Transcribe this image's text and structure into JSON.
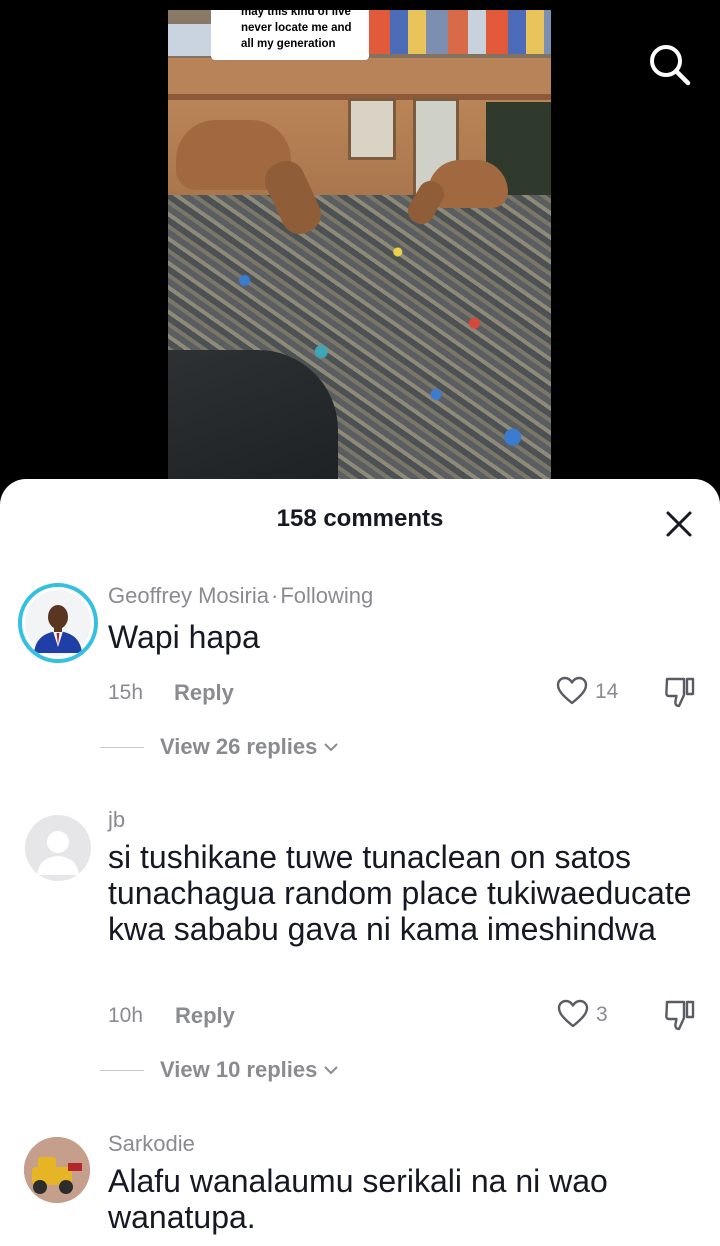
{
  "video": {
    "caption_lines": [
      "may this kind of live",
      "never locate me and",
      "all my generation"
    ]
  },
  "sheet": {
    "title": "158 comments"
  },
  "comments": [
    {
      "author": "Geoffrey Mosiria",
      "badge": "Following",
      "text": "Wapi hapa",
      "time": "15h",
      "reply_label": "Reply",
      "likes": "14",
      "view_replies": "View 26 replies"
    },
    {
      "author": "jb",
      "text": "si tushikane tuwe tunaclean on satos tunachagua random place tukiwaeducate kwa sababu gava ni kama imeshindwa",
      "time": "10h",
      "reply_label": "Reply",
      "likes": "3",
      "view_replies": "View 10 replies"
    },
    {
      "author": "Sarkodie",
      "text": "Alafu wanalaumu serikali na ni wao wanatupa."
    }
  ],
  "colors": {
    "accent_ring": "#35c0e0",
    "text_primary": "#161823",
    "text_secondary": "#8a8b91"
  },
  "icons": [
    "search-icon",
    "close-icon",
    "heart-icon",
    "dislike-icon",
    "chevron-down-icon",
    "default-avatar-icon"
  ]
}
